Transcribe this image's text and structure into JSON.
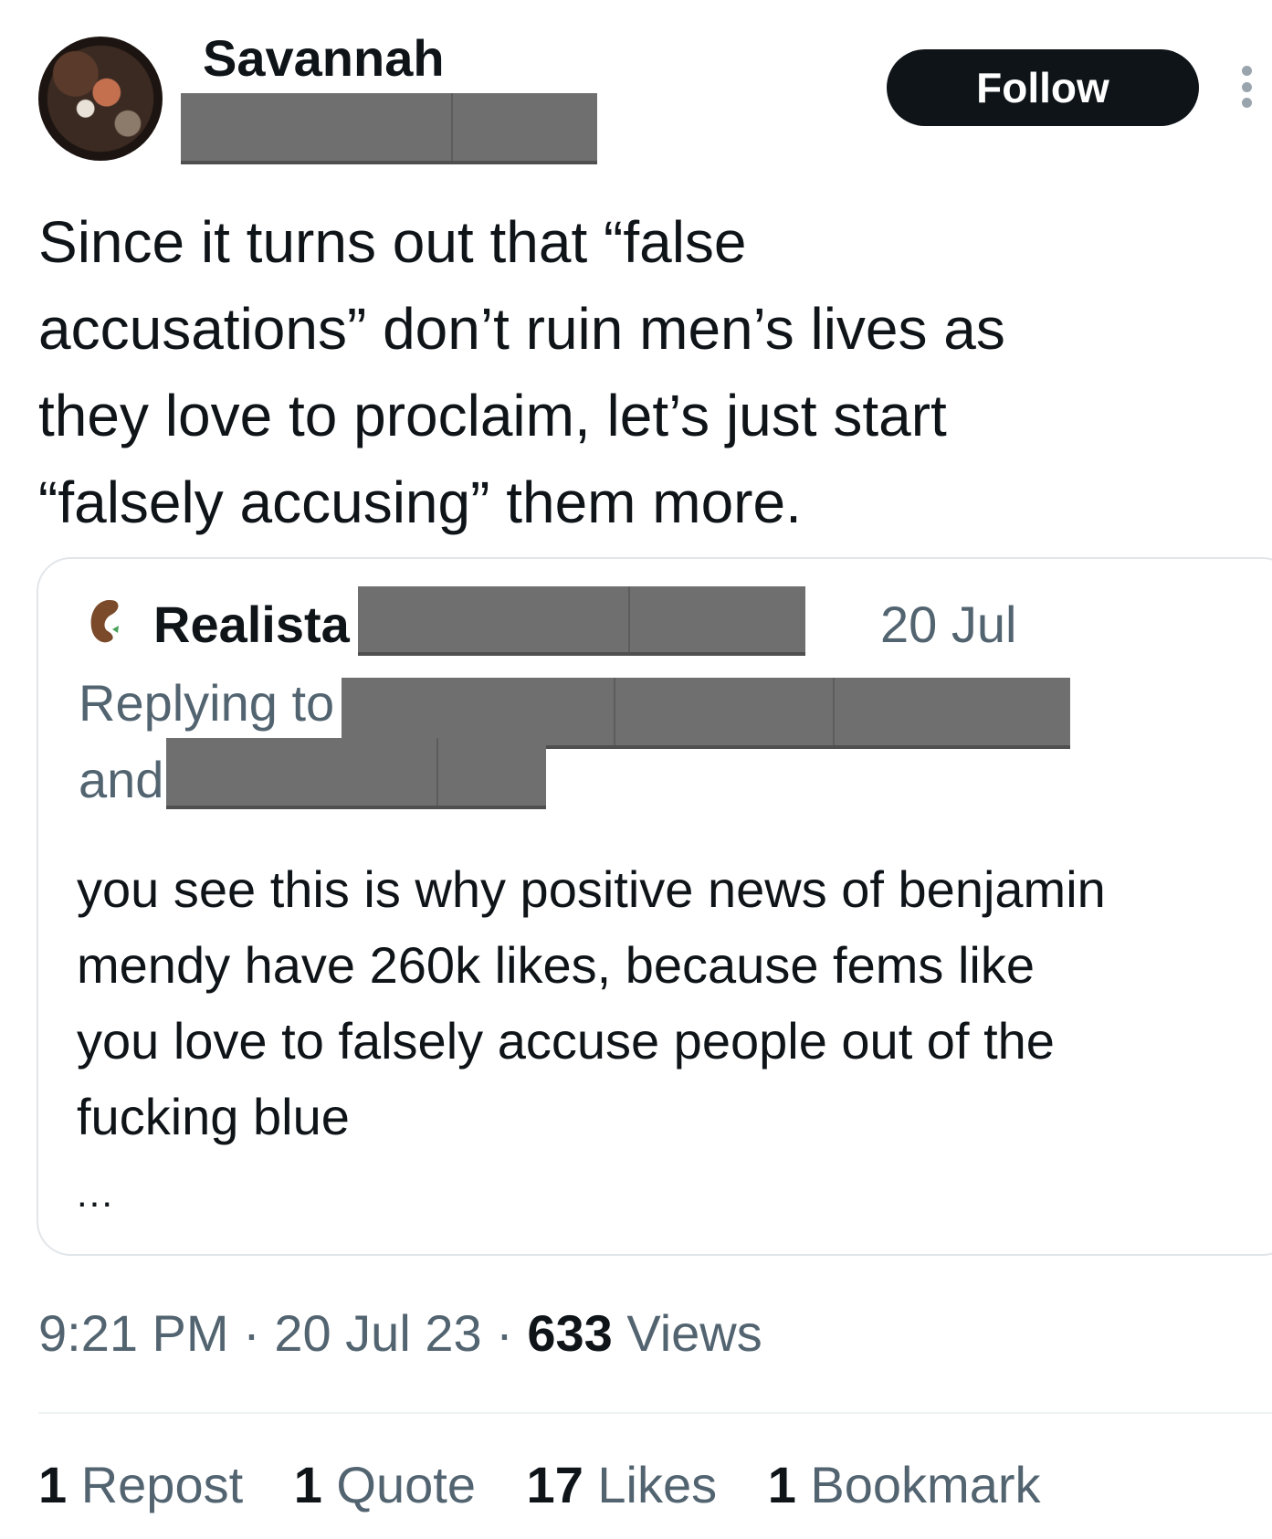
{
  "author": {
    "name": "Savannah",
    "avatar_icon": "profile-photo"
  },
  "follow_label": "Follow",
  "more_icon": "vertical-ellipsis-icon",
  "tweet_text": "Since it turns out that “false\naccusations” don’t ruin men’s lives as\nthey love to proclaim, let’s just start\n“falsely accusing” them more.",
  "quote": {
    "author_icon": "kidney-bean-icon",
    "author_name": "Realista",
    "date": "20 Jul",
    "replying_to_label": "Replying to",
    "and_label": "and",
    "body": "you see this is why positive news of benjamin\nmendy have 260k likes, because fems like\nyou love to falsely accuse people out of the\nfucking blue",
    "ellipsis": "..."
  },
  "meta": {
    "time": "9:21 PM",
    "sep1": " · ",
    "date": "20 Jul 23",
    "sep2": " · ",
    "views_count": "633",
    "views_label": " Views"
  },
  "stats": [
    {
      "count": "1",
      "label": " Repost"
    },
    {
      "count": "1",
      "label": " Quote"
    },
    {
      "count": "17",
      "label": " Likes"
    },
    {
      "count": "1",
      "label": " Bookmark"
    }
  ],
  "colors": {
    "text": "#0f1419",
    "secondary": "#536471",
    "follow_bg": "#0f1419",
    "redaction": "#6f6f6f",
    "border": "#e1e6ea"
  }
}
